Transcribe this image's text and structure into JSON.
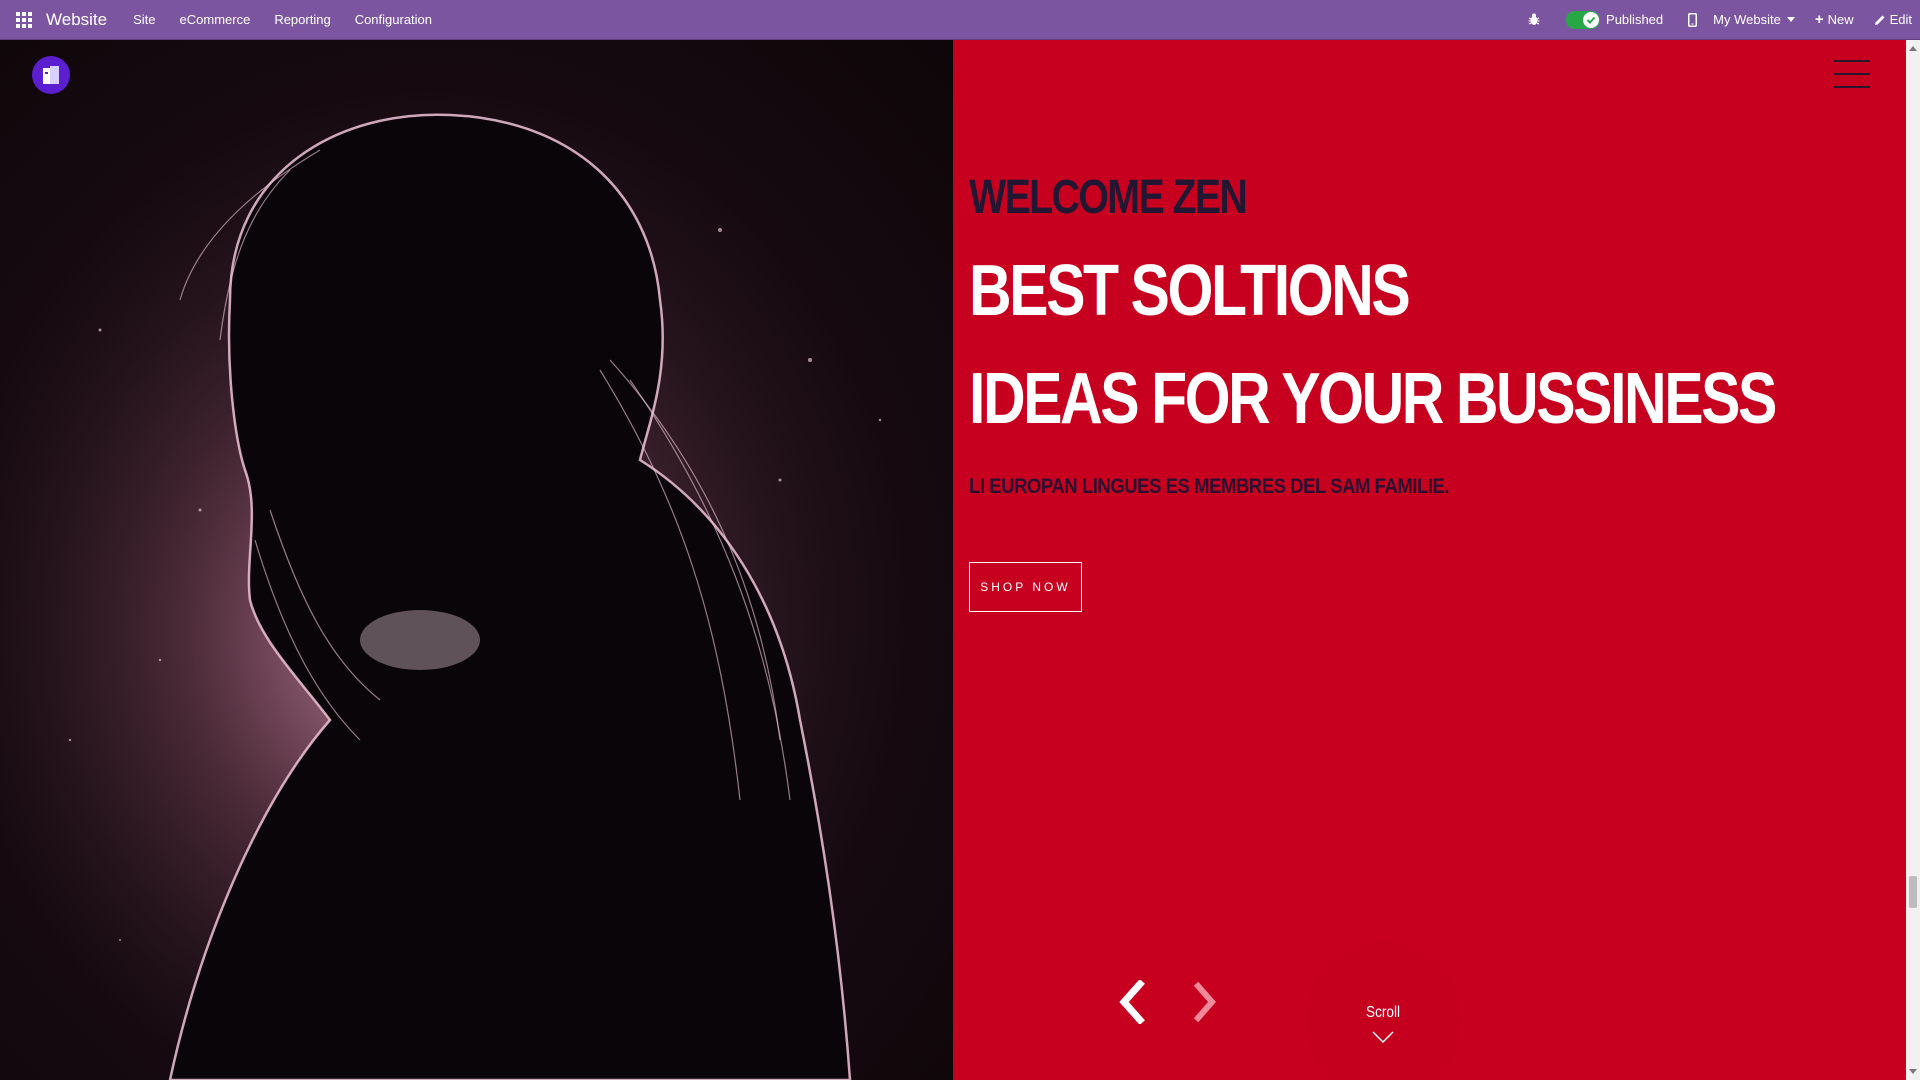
{
  "navbar": {
    "apps_icon": "apps-grid-icon",
    "brand": "Website",
    "menu": [
      "Site",
      "eCommerce",
      "Reporting",
      "Configuration"
    ],
    "published_label": "Published",
    "website_label": "My Website",
    "new_label": "New",
    "edit_label": "Edit",
    "accent": "#7c55a0"
  },
  "hero": {
    "welcome": "WELCOME ZEN",
    "title_line1": "BEST SOLTIONS",
    "title_line2": "IDEAS FOR YOUR BUSSINESS",
    "subtitle": "LI EUROPAN LINGUES ES MEMBRES DEL SAM FAMILIE.",
    "cta_label": "SHOP NOW",
    "scroll_label": "Scroll",
    "panel_color": "#c8001f"
  }
}
